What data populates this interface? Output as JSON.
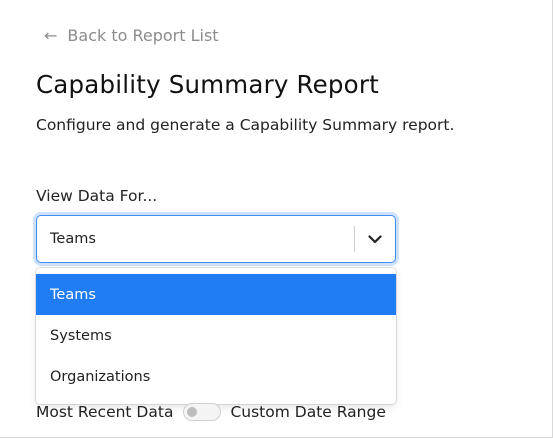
{
  "back_link": {
    "label": "Back to Report List",
    "icon": "arrow-left-icon"
  },
  "page": {
    "title": "Capability Summary Report",
    "description": "Configure and generate a Capability Summary report."
  },
  "view_data_for": {
    "label": "View Data For...",
    "selected_value": "Teams",
    "options": [
      "Teams",
      "Systems",
      "Organizations"
    ],
    "highlighted_option": "Teams"
  },
  "date_mode": {
    "left_label": "Most Recent Data",
    "right_label": "Custom Date Range",
    "toggle_on": false
  },
  "colors": {
    "accent": "#1f7cf3",
    "focus_border": "#3e8ff5",
    "muted_text": "#8c8c8c"
  }
}
